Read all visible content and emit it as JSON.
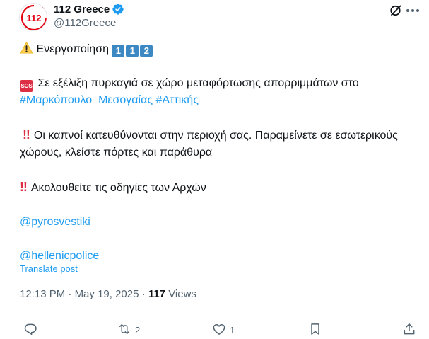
{
  "post": {
    "display_name": "112 Greece",
    "handle": "@112Greece",
    "avatar_text": "112",
    "activation_text": "Ενεργοποίηση",
    "activation_numbers": [
      "1",
      "1",
      "2"
    ],
    "sos_badge": "SOS",
    "line1": "Σε εξέλιξη πυρκαγιά σε χώρο μεταφόρτωσης απορριμμάτων στο",
    "hashtag1": "#Μαρκόπουλο_Μεσογαίας",
    "hashtag2": "#Αττικής",
    "bang": "‼",
    "line2": "Οι καπνοί κατευθύνονται στην περιοχή σας. Παραμείνετε σε εσωτερικούς χώρους, κλείστε πόρτες και παράθυρα",
    "line3": "Ακολουθείτε τις οδηγίες των Αρχών",
    "mention1": "@pyrosvestiki",
    "mention2": "@hellenicpolice",
    "translate_label": "Translate post",
    "time": "12:13 PM",
    "date": "May 19, 2025",
    "views_count": "117",
    "views_label": "Views"
  },
  "actions": {
    "reply_count": "",
    "repost_count": "2",
    "like_count": "1"
  },
  "colors": {
    "link": "#1d9bf0",
    "muted": "#536471",
    "text": "#0f1419",
    "verified": "#1d9bf0",
    "brand_red": "#e30613"
  },
  "icons": {
    "verified": "verified-badge-icon",
    "grok": "grok-icon",
    "more": "more-dots-icon",
    "warning": "warning-icon",
    "reply": "reply-icon",
    "repost": "repost-icon",
    "like": "heart-icon",
    "bookmark": "bookmark-icon",
    "share": "share-icon"
  }
}
